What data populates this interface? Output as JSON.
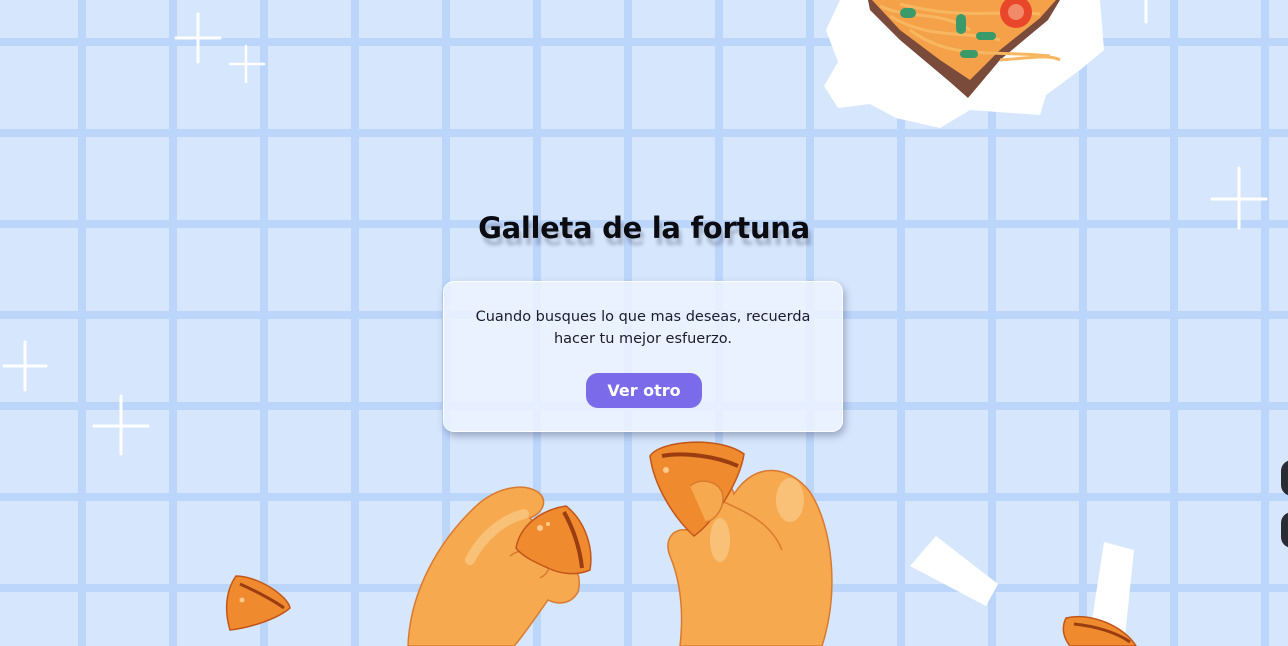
{
  "page": {
    "title": "Galleta de la fortuna",
    "fortune_text": "Cuando busques lo que mas deseas, recuerda hacer tu mejor esfuerzo.",
    "button_label": "Ver otro"
  },
  "colors": {
    "background": "#d6e6fd",
    "grid_lines": "#bcd5fb",
    "button": "#7b6ae9",
    "cookie": "#f08a2e",
    "hand": "#f6a94e"
  },
  "icons": [
    "sparkle-icon",
    "noodle-box-illustration",
    "fortune-cookie-icon",
    "hands-holding-cookie-illustration",
    "paper-slip-icon"
  ]
}
